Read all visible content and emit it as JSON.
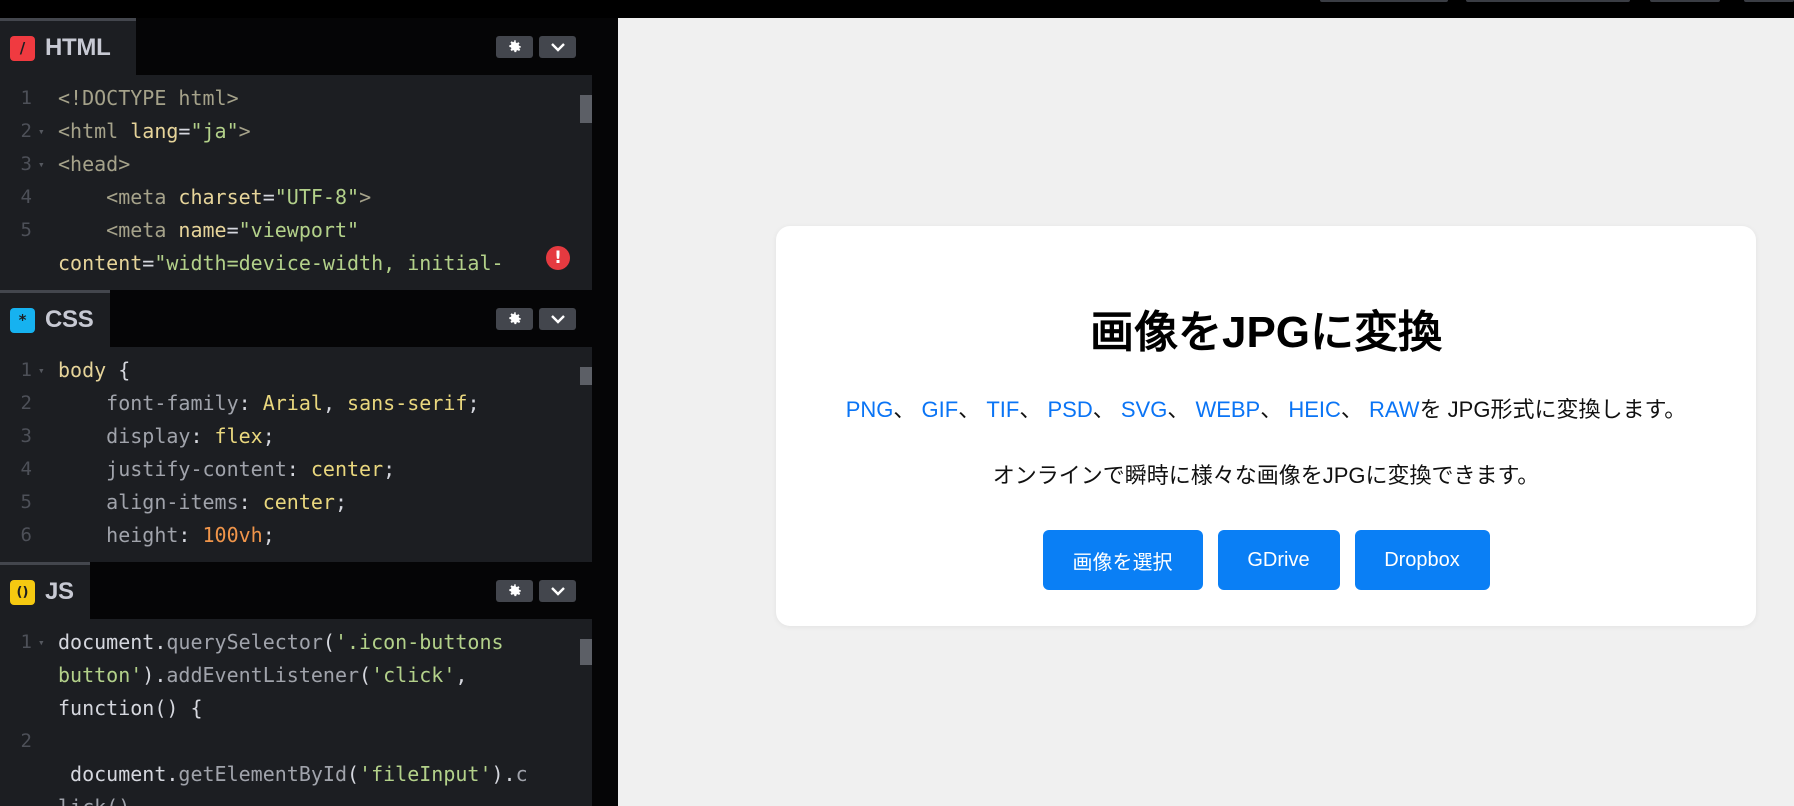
{
  "editor": {
    "html": {
      "tab_label": "HTML",
      "icon_glyph": "/",
      "icon_color": "#f03a40",
      "lines": [
        {
          "num": "1",
          "fold": "",
          "tokens": [
            {
              "t": "<!DOCTYPE html>",
              "c": "c-tag"
            }
          ]
        },
        {
          "num": "2",
          "fold": "▾",
          "tokens": [
            {
              "t": "<html ",
              "c": "c-tag"
            },
            {
              "t": "lang",
              "c": "c-attr"
            },
            {
              "t": "=",
              "c": "c-punc"
            },
            {
              "t": "\"ja\"",
              "c": "c-str"
            },
            {
              "t": ">",
              "c": "c-tag"
            }
          ]
        },
        {
          "num": "3",
          "fold": "▾",
          "tokens": [
            {
              "t": "<head>",
              "c": "c-tag"
            }
          ]
        },
        {
          "num": "4",
          "fold": "",
          "tokens": [
            {
              "t": "    <meta ",
              "c": "c-tag"
            },
            {
              "t": "charset",
              "c": "c-attr"
            },
            {
              "t": "=",
              "c": "c-punc"
            },
            {
              "t": "\"UTF-8\"",
              "c": "c-str"
            },
            {
              "t": ">",
              "c": "c-tag"
            }
          ]
        },
        {
          "num": "5",
          "fold": "",
          "tokens": [
            {
              "t": "    <meta ",
              "c": "c-tag"
            },
            {
              "t": "name",
              "c": "c-attr"
            },
            {
              "t": "=",
              "c": "c-punc"
            },
            {
              "t": "\"viewport\"",
              "c": "c-str"
            }
          ]
        },
        {
          "num": "",
          "fold": "",
          "tokens": [
            {
              "t": "content",
              "c": "c-attr"
            },
            {
              "t": "=",
              "c": "c-punc"
            },
            {
              "t": "\"width=device-width, initial-",
              "c": "c-str"
            }
          ]
        }
      ],
      "error_icon": "!"
    },
    "css": {
      "tab_label": "CSS",
      "icon_glyph": "*",
      "icon_color": "#16b2f0",
      "lines": [
        {
          "num": "1",
          "fold": "▾",
          "tokens": [
            {
              "t": "body",
              "c": "c-sel"
            },
            {
              "t": " {",
              "c": "c-punc"
            }
          ]
        },
        {
          "num": "2",
          "fold": "",
          "tokens": [
            {
              "t": "    font-family",
              "c": "c-prop"
            },
            {
              "t": ": ",
              "c": "c-punc"
            },
            {
              "t": "Arial",
              "c": "c-val"
            },
            {
              "t": ", ",
              "c": "c-punc"
            },
            {
              "t": "sans-serif",
              "c": "c-val"
            },
            {
              "t": ";",
              "c": "c-punc"
            }
          ]
        },
        {
          "num": "3",
          "fold": "",
          "tokens": [
            {
              "t": "    display",
              "c": "c-prop"
            },
            {
              "t": ": ",
              "c": "c-punc"
            },
            {
              "t": "flex",
              "c": "c-val"
            },
            {
              "t": ";",
              "c": "c-punc"
            }
          ]
        },
        {
          "num": "4",
          "fold": "",
          "tokens": [
            {
              "t": "    justify-content",
              "c": "c-prop"
            },
            {
              "t": ": ",
              "c": "c-punc"
            },
            {
              "t": "center",
              "c": "c-val"
            },
            {
              "t": ";",
              "c": "c-punc"
            }
          ]
        },
        {
          "num": "5",
          "fold": "",
          "tokens": [
            {
              "t": "    align-items",
              "c": "c-prop"
            },
            {
              "t": ": ",
              "c": "c-punc"
            },
            {
              "t": "center",
              "c": "c-val"
            },
            {
              "t": ";",
              "c": "c-punc"
            }
          ]
        },
        {
          "num": "6",
          "fold": "",
          "tokens": [
            {
              "t": "    height",
              "c": "c-prop"
            },
            {
              "t": ": ",
              "c": "c-punc"
            },
            {
              "t": "100vh",
              "c": "c-num"
            },
            {
              "t": ";",
              "c": "c-punc"
            }
          ]
        }
      ]
    },
    "js": {
      "tab_label": "JS",
      "icon_glyph": "()",
      "icon_color": "#f5c911",
      "lines": [
        {
          "num": "1",
          "fold": "▾",
          "tokens": [
            {
              "t": "document",
              "c": "c-plain"
            },
            {
              "t": ".",
              "c": "c-punc"
            },
            {
              "t": "querySelector",
              "c": "c-fn"
            },
            {
              "t": "(",
              "c": "c-punc"
            },
            {
              "t": "'.icon-buttons",
              "c": "c-str"
            }
          ]
        },
        {
          "num": "",
          "fold": "",
          "tokens": [
            {
              "t": "button'",
              "c": "c-str"
            },
            {
              "t": ").",
              "c": "c-punc"
            },
            {
              "t": "addEventListener",
              "c": "c-fn"
            },
            {
              "t": "(",
              "c": "c-punc"
            },
            {
              "t": "'click'",
              "c": "c-str"
            },
            {
              "t": ",",
              "c": "c-punc"
            }
          ]
        },
        {
          "num": "",
          "fold": "",
          "tokens": [
            {
              "t": "function",
              "c": "c-plain"
            },
            {
              "t": "() {",
              "c": "c-punc"
            }
          ]
        },
        {
          "num": "2",
          "fold": "",
          "tokens": []
        },
        {
          "num": "",
          "fold": "",
          "tokens": [
            {
              "t": " document",
              "c": "c-plain"
            },
            {
              "t": ".",
              "c": "c-punc"
            },
            {
              "t": "getElementById",
              "c": "c-fn"
            },
            {
              "t": "(",
              "c": "c-punc"
            },
            {
              "t": "'fileInput'",
              "c": "c-str"
            },
            {
              "t": ").",
              "c": "c-punc"
            },
            {
              "t": "c",
              "c": "c-fn"
            }
          ]
        },
        {
          "num": "",
          "fold": "",
          "tokens": [
            {
              "t": "lick()",
              "c": "c-fn"
            }
          ]
        }
      ]
    }
  },
  "preview": {
    "title": "画像をJPGに変換",
    "formats": [
      "PNG",
      "GIF",
      "TIF",
      "PSD",
      "SVG",
      "WEBP",
      "HEIC",
      "RAW"
    ],
    "format_separator": "、 ",
    "format_suffix": "を JPG形式に変換します。",
    "subtitle": "オンラインで瞬時に様々な画像をJPGに変換できます。",
    "buttons": {
      "select_label": "画像を選択",
      "gdrive_label": "GDrive",
      "dropbox_label": "Dropbox"
    },
    "accent_color": "#0a7ff5",
    "link_color": "#0a74f5"
  }
}
